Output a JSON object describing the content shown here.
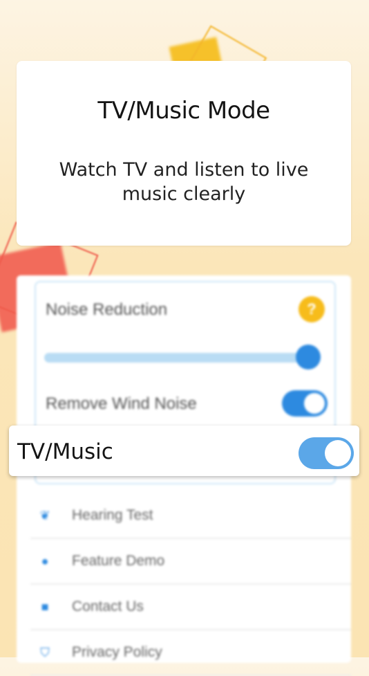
{
  "info_card": {
    "title": "TV/Music Mode",
    "subtitle": "Watch TV and listen to live music clearly"
  },
  "panel": {
    "noise_reduction_label": "Noise Reduction",
    "help_icon": "?",
    "noise_reduction_level": 1.0,
    "wind_noise_label": "Remove Wind Noise",
    "wind_noise_enabled": true
  },
  "highlight": {
    "label": "TV/Music",
    "enabled": true
  },
  "menu": {
    "items": [
      {
        "label": "Hearing Test",
        "icon": "ear-icon",
        "glyph": "❦"
      },
      {
        "label": "Feature Demo",
        "icon": "chat-bubble-icon",
        "glyph": "●"
      },
      {
        "label": "Contact Us",
        "icon": "contact-card-icon",
        "glyph": "■"
      },
      {
        "label": "Privacy Policy",
        "icon": "shield-icon",
        "glyph": "⛉"
      }
    ]
  },
  "colors": {
    "accent": "#2d8ae0",
    "toggle_on": "#5ba7e8",
    "help_yellow": "#f7bc1b"
  }
}
